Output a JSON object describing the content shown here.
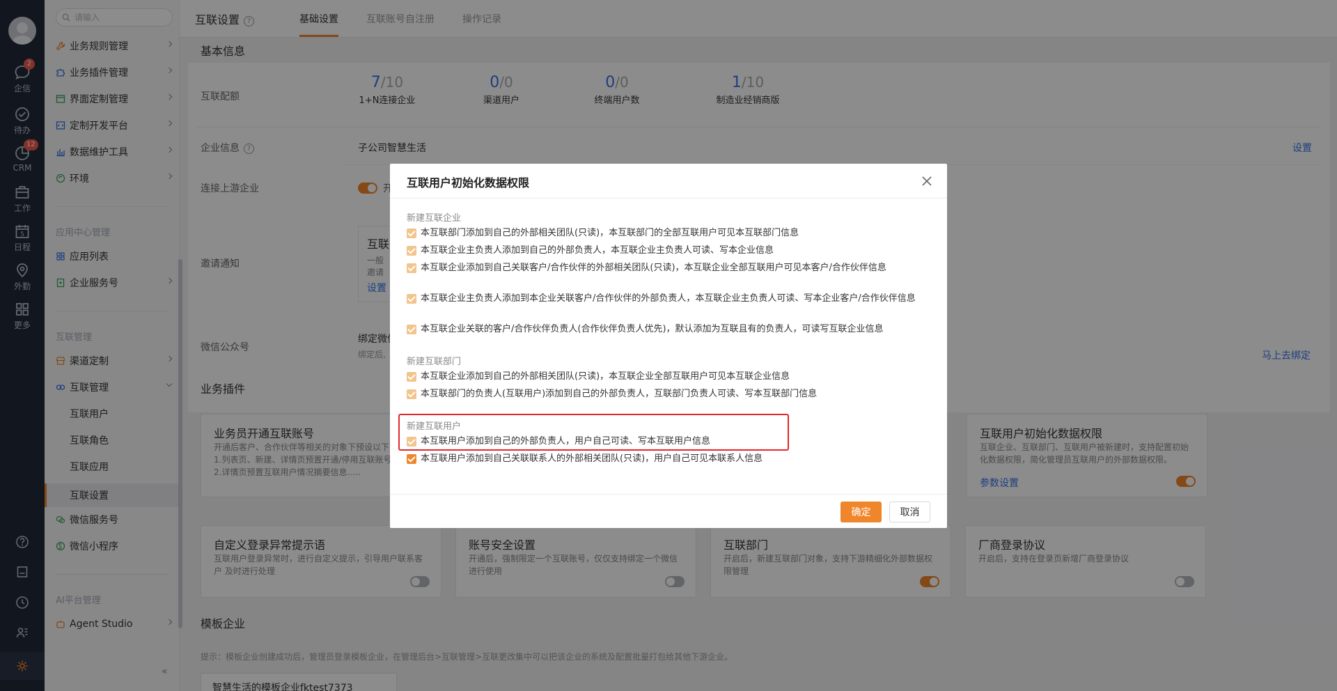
{
  "rail": {
    "items": [
      {
        "label": "企信",
        "badge": "2"
      },
      {
        "label": "待办",
        "badge": ""
      },
      {
        "label": "CRM",
        "badge": "12"
      },
      {
        "label": "工作",
        "badge": ""
      },
      {
        "label": "日程",
        "badge": "",
        "day": "5"
      },
      {
        "label": "外勤",
        "badge": ""
      },
      {
        "label": "更多",
        "badge": ""
      }
    ]
  },
  "sidebar": {
    "search_placeholder": "请输入",
    "items_top": [
      "业务规则管理",
      "业务插件管理",
      "界面定制管理",
      "定制开发平台",
      "数据维护工具",
      "环境"
    ],
    "group_app": "应用中心管理",
    "items_app": [
      "应用列表",
      "企业服务号"
    ],
    "group_link": "互联管理",
    "items_link": [
      "渠道定制",
      "互联管理"
    ],
    "sub_link": [
      "互联用户",
      "互联角色",
      "互联应用",
      "互联设置"
    ],
    "items_wx": [
      "微信服务号",
      "微信小程序"
    ],
    "group_ai": "AI平台管理",
    "items_ai": [
      "Agent Studio"
    ],
    "collapse": "«"
  },
  "header": {
    "title": "互联设置",
    "help": "?",
    "tabs": [
      "基础设置",
      "互联账号自注册",
      "操作记录"
    ]
  },
  "main": {
    "basic_info": "基本信息",
    "quota_label": "互联配额",
    "quotas": [
      {
        "num": "7",
        "den": "/10",
        "label": "1+N连接企业"
      },
      {
        "num": "0",
        "den": "/0",
        "label": "渠道用户"
      },
      {
        "num": "0",
        "den": "/0",
        "label": "终端用户数"
      },
      {
        "num": "1",
        "den": "/10",
        "label": "制造业经销商版"
      }
    ],
    "enterprise_label": "企业信息",
    "enterprise_value": "子公司智慧生活",
    "enterprise_link": "设置",
    "upstream_label": "连接上游企业",
    "upstream_text": "开",
    "invite_label": "邀请通知",
    "invite_title": "互联",
    "invite_desc1": "一般",
    "invite_desc2": "邀请",
    "invite_link": "设置",
    "wechat_label": "微信公众号",
    "wechat_value": "绑定微信",
    "wechat_desc": "绑定后,",
    "wechat_link": "马上去绑定",
    "plugins_title": "业务插件",
    "card1_title": "业务员开通互联账号",
    "card1_desc": "开通后客户、合作伙伴等相关的对象下预设以下\n1.列表页、新建、详情页预置开通/停用互联账号\n2.详情页预置互联用户情况摘要信息.....",
    "card2_title": "互联用户初始化数据权限",
    "card2_desc": "互联企业、互联部门、互联用户被新建时，支持配置初始化数据权限，简化管理员互联用户的外部数据权限。",
    "card2_link": "参数设置",
    "card3_title": "自定义登录异常提示语",
    "card3_desc": "互联用户登录异常时，进行自定义提示，引导用户联系客户 及时进行处理",
    "card4_title": "账号安全设置",
    "card4_desc": "开通后，强制限定一个互联账号，仅仅支持绑定一个微信进行使用",
    "card5_title": "互联部门",
    "card5_desc": "开启后，新建互联部门对象，支持下游精细化外部数据权限管理",
    "card6_title": "厂商登录协议",
    "card6_desc": "开启后，支持在登录页新增厂商登录协议",
    "template_title": "模板企业",
    "template_hint": "提示：模板企业创建成功后，管理员登录模板企业，在管理后台>互联管理>互联更改集中可以把该企业的系统及配置批量打包给其他下游企业。",
    "template_name": "智慧生活的模板企业fktest7373"
  },
  "modal": {
    "title": "互联用户初始化数据权限",
    "group1": "新建互联企业",
    "group1_items": [
      "本互联部门添加到自己的外部相关团队(只读)，本互联部门的全部互联用户可见本互联部门信息",
      "本互联企业主负责人添加到自己的外部负责人，本互联企业主负责人可读、写本企业信息",
      "本互联企业添加到自己关联客户/合作伙伴的外部相关团队(只读)，本互联企业全部互联用户可见本客户/合作伙伴信息",
      "本互联企业主负责人添加到本企业关联客户/合作伙伴的外部负责人，本互联企业主负责人可读、写本企业客户/合作伙伴信息",
      "本互联企业关联的客户/合作伙伴负责人(合作伙伴负责人优先)，默认添加为互联且有的负责人，可读写互联企业信息"
    ],
    "group2": "新建互联部门",
    "group2_items": [
      "本互联企业添加到自己的外部相关团队(只读)，本互联企业全部互联用户可见本互联企业信息",
      "本互联部门的负责人(互联用户)添加到自己的外部负责人，互联部门负责人可读、写本互联部门信息"
    ],
    "group3": "新建互联用户",
    "group3_items": [
      "本互联用户添加到自己的外部负责人，用户自己可读、写本互联用户信息",
      "本互联用户添加到自己关联联系人的外部相关团队(只读)，用户自己可见本联系人信息"
    ],
    "ok": "确定",
    "cancel": "取消"
  },
  "colors": {
    "accent": "#f0862b",
    "link": "#3574e6",
    "highlight": "#e3262b"
  }
}
